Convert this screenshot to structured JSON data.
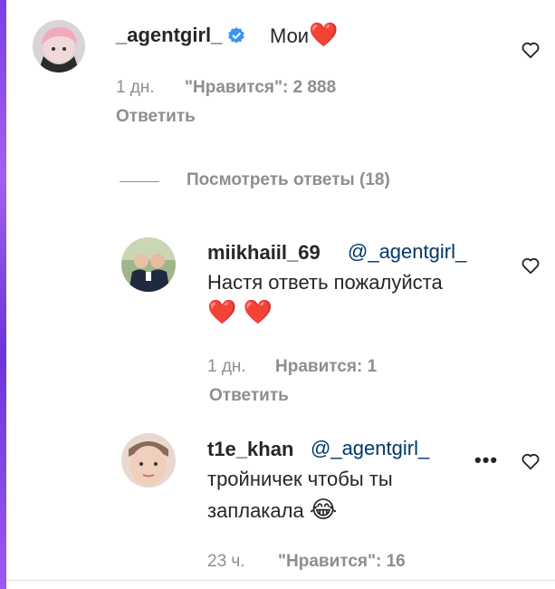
{
  "main_comment": {
    "username": "_agentgirl_",
    "text": "Мои",
    "emoji": "❤️",
    "time": "1 дн.",
    "likes": "\"Нравится\": 2 888",
    "reply_label": "Ответить"
  },
  "view_replies": {
    "label": "Посмотреть ответы (18)"
  },
  "replies": [
    {
      "username": "miikhaiil_69",
      "mention": "@_agentgirl_",
      "text_line1": "Настя ответь пожалуйста",
      "text_line2": "❤️ ❤️",
      "time": "1 дн.",
      "likes": "Нравится: 1",
      "reply_label": "Ответить"
    },
    {
      "username": "t1e_khan",
      "mention": "@_agentgirl_",
      "text_line1": "тройничек чтобы ты",
      "text_line2": "заплакала",
      "emoji": "😂",
      "time": "23 ч.",
      "likes": "\"Нравится\": 16",
      "more_icon": "•••"
    }
  ],
  "colors": {
    "text": "#262626",
    "secondary": "#8e8e8e",
    "mention": "#00376b",
    "verified": "#3897f0",
    "heart_red": "#ed4956",
    "accent_bar": "#7b3fe4"
  },
  "icons": [
    "heart-outline-icon",
    "verified-badge-icon",
    "more-options-icon",
    "avatar"
  ]
}
